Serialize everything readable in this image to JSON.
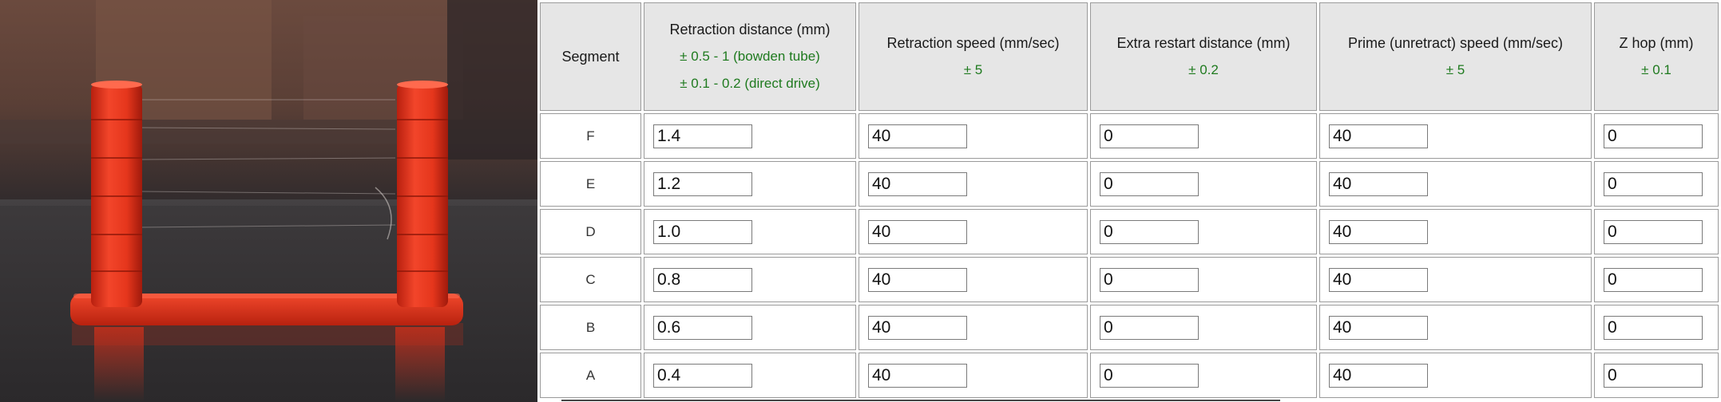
{
  "photo": {
    "alt": "3D printed retraction test towers",
    "part_color": "#e8341f"
  },
  "table": {
    "colors": {
      "header_bg": "#e6e6e6",
      "tolerance_text": "#1f7a1f",
      "border": "#9a9a9a"
    },
    "headers": [
      {
        "key": "segment",
        "title": "Segment",
        "tolerances": []
      },
      {
        "key": "retraction_distance",
        "title": "Retraction distance (mm)",
        "tolerances": [
          "± 0.5 - 1 (bowden tube)",
          "± 0.1 - 0.2 (direct drive)"
        ]
      },
      {
        "key": "retraction_speed",
        "title": "Retraction speed (mm/sec)",
        "tolerances": [
          "± 5"
        ]
      },
      {
        "key": "extra_restart_distance",
        "title": "Extra restart distance (mm)",
        "tolerances": [
          "± 0.2"
        ]
      },
      {
        "key": "prime_speed",
        "title": "Prime (unretract) speed (mm/sec)",
        "tolerances": [
          "± 5"
        ]
      },
      {
        "key": "z_hop",
        "title": "Z hop (mm)",
        "tolerances": [
          "± 0.1"
        ]
      }
    ],
    "rows": [
      {
        "segment": "F",
        "retraction_distance": "1.4",
        "retraction_speed": "40",
        "extra_restart_distance": "0",
        "prime_speed": "40",
        "z_hop": "0"
      },
      {
        "segment": "E",
        "retraction_distance": "1.2",
        "retraction_speed": "40",
        "extra_restart_distance": "0",
        "prime_speed": "40",
        "z_hop": "0"
      },
      {
        "segment": "D",
        "retraction_distance": "1.0",
        "retraction_speed": "40",
        "extra_restart_distance": "0",
        "prime_speed": "40",
        "z_hop": "0"
      },
      {
        "segment": "C",
        "retraction_distance": "0.8",
        "retraction_speed": "40",
        "extra_restart_distance": "0",
        "prime_speed": "40",
        "z_hop": "0"
      },
      {
        "segment": "B",
        "retraction_distance": "0.6",
        "retraction_speed": "40",
        "extra_restart_distance": "0",
        "prime_speed": "40",
        "z_hop": "0"
      },
      {
        "segment": "A",
        "retraction_distance": "0.4",
        "retraction_speed": "40",
        "extra_restart_distance": "0",
        "prime_speed": "40",
        "z_hop": "0"
      }
    ]
  }
}
